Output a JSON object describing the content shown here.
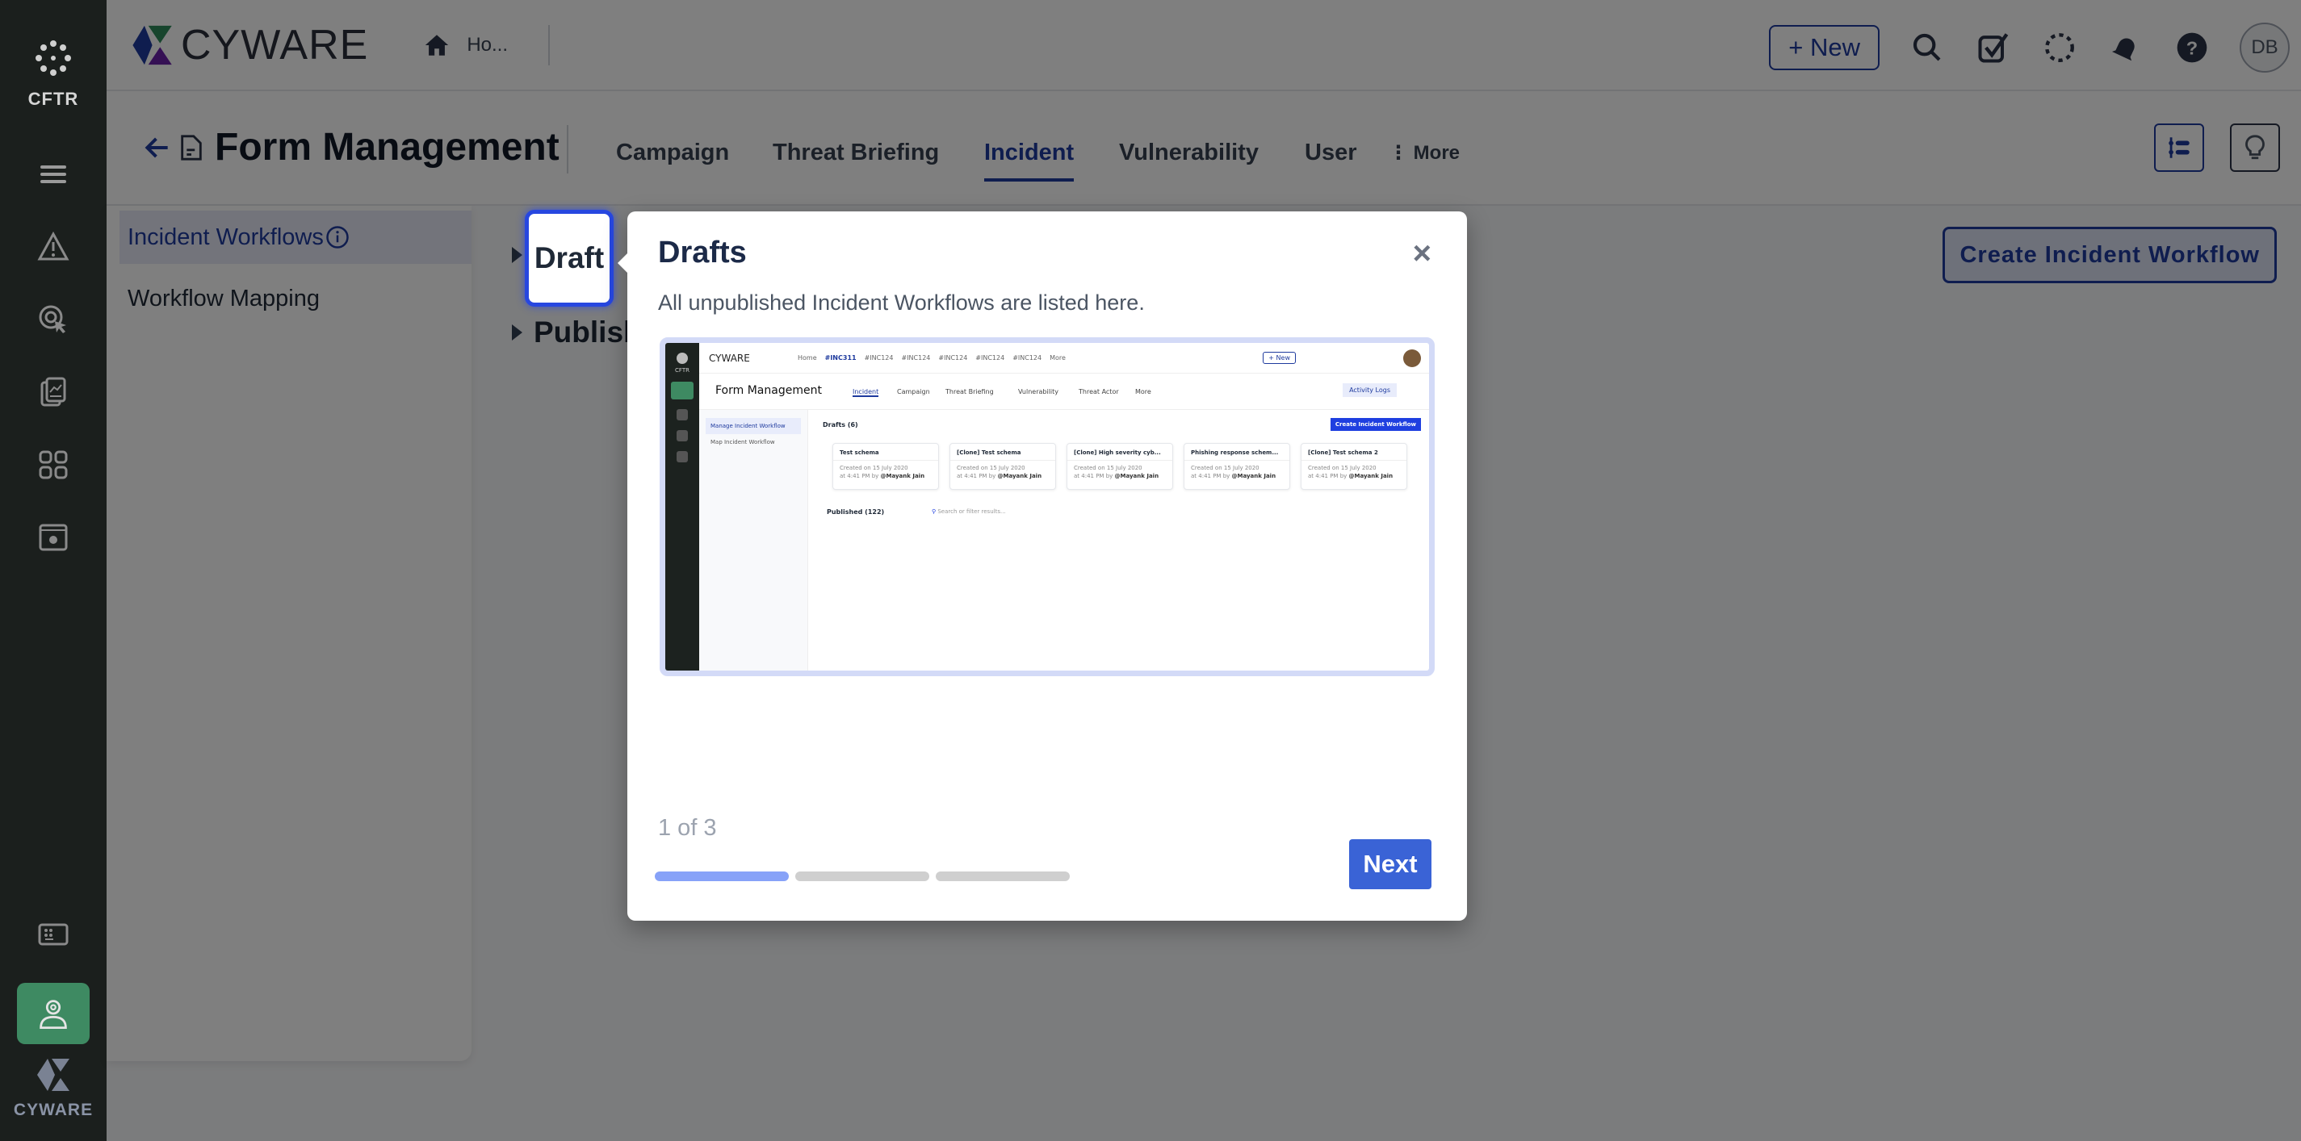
{
  "rail": {
    "brand_label": "CFTR",
    "items": [
      {
        "icon": "menu-icon"
      },
      {
        "icon": "alert-triangle-icon"
      },
      {
        "icon": "target-cursor-icon"
      },
      {
        "icon": "report-icon"
      },
      {
        "icon": "apps-grid-icon"
      },
      {
        "icon": "settings-window-icon"
      }
    ],
    "bottom_items": [
      {
        "icon": "keyboard-icon"
      },
      {
        "icon": "user-settings-icon",
        "active": true
      }
    ],
    "footer_label": "CYWARE"
  },
  "header": {
    "logo_text": "CYWARE",
    "home_label": "Ho...",
    "new_button": "+ New",
    "icons": [
      "search-icon",
      "tasks-check-icon",
      "loading-icon",
      "bell-icon",
      "help-icon"
    ],
    "avatar_initials": "DB"
  },
  "page": {
    "title": "Form Management",
    "tabs": [
      {
        "label": "Campaign",
        "active": false
      },
      {
        "label": "Threat Briefing",
        "active": false
      },
      {
        "label": "Incident",
        "active": true
      },
      {
        "label": "Vulnerability",
        "active": false
      },
      {
        "label": "User",
        "active": false
      }
    ],
    "more_label": "More"
  },
  "leftnav": {
    "items": [
      {
        "label": "Incident Workflows",
        "active": true
      },
      {
        "label": "Workflow Mapping",
        "active": false
      }
    ]
  },
  "content": {
    "sections": [
      "Draft",
      "Publish"
    ],
    "create_button": "Create Incident Workflow"
  },
  "tour": {
    "highlight_label": "Draft",
    "title": "Drafts",
    "close": "×",
    "description": "All unpublished Incident Workflows are listed here.",
    "step_text": "1 of 3",
    "progress": {
      "current": 1,
      "total": 3
    },
    "next_button": "Next",
    "preview": {
      "logo": "CYWARE",
      "rail_label": "CFTR",
      "top_tabs": [
        "Home",
        "#INC311",
        "#INC124",
        "#INC124",
        "#INC124",
        "#INC124",
        "#INC124",
        "More"
      ],
      "new_button": "+ New",
      "title": "Form Management",
      "tabs": [
        "Incident",
        "Campaign",
        "Threat Briefing",
        "Vulnerability",
        "Threat Actor",
        "More"
      ],
      "activity_logs": "Activity Logs",
      "nav": [
        "Manage Incident Workflow",
        "Map Incident Workflow"
      ],
      "drafts_label": "Drafts (6)",
      "create_button": "Create Incident Workflow",
      "cards": [
        {
          "title": "Test schema",
          "meta1": "Created on 15 July 2020",
          "meta2": "at 4:41 PM by",
          "user": "@Mayank Jain"
        },
        {
          "title": "[Clone] Test schema",
          "meta1": "Created on 15 July 2020",
          "meta2": "at 4:41 PM by",
          "user": "@Mayank Jain"
        },
        {
          "title": "[Clone] High severity cyb...",
          "meta1": "Created on 15 July 2020",
          "meta2": "at 4:41 PM by",
          "user": "@Mayank Jain"
        },
        {
          "title": "Phishing response schem...",
          "meta1": "Created on 15 July 2020",
          "meta2": "at 4:41 PM by",
          "user": "@Mayank Jain"
        },
        {
          "title": "[Clone] Test schema 2",
          "meta1": "Created on 15 July 2020",
          "meta2": "at 4:41 PM by",
          "user": "@Mayank Jain"
        }
      ],
      "published_label": "Published (122)",
      "search_placeholder": "Search or filter results..."
    }
  }
}
